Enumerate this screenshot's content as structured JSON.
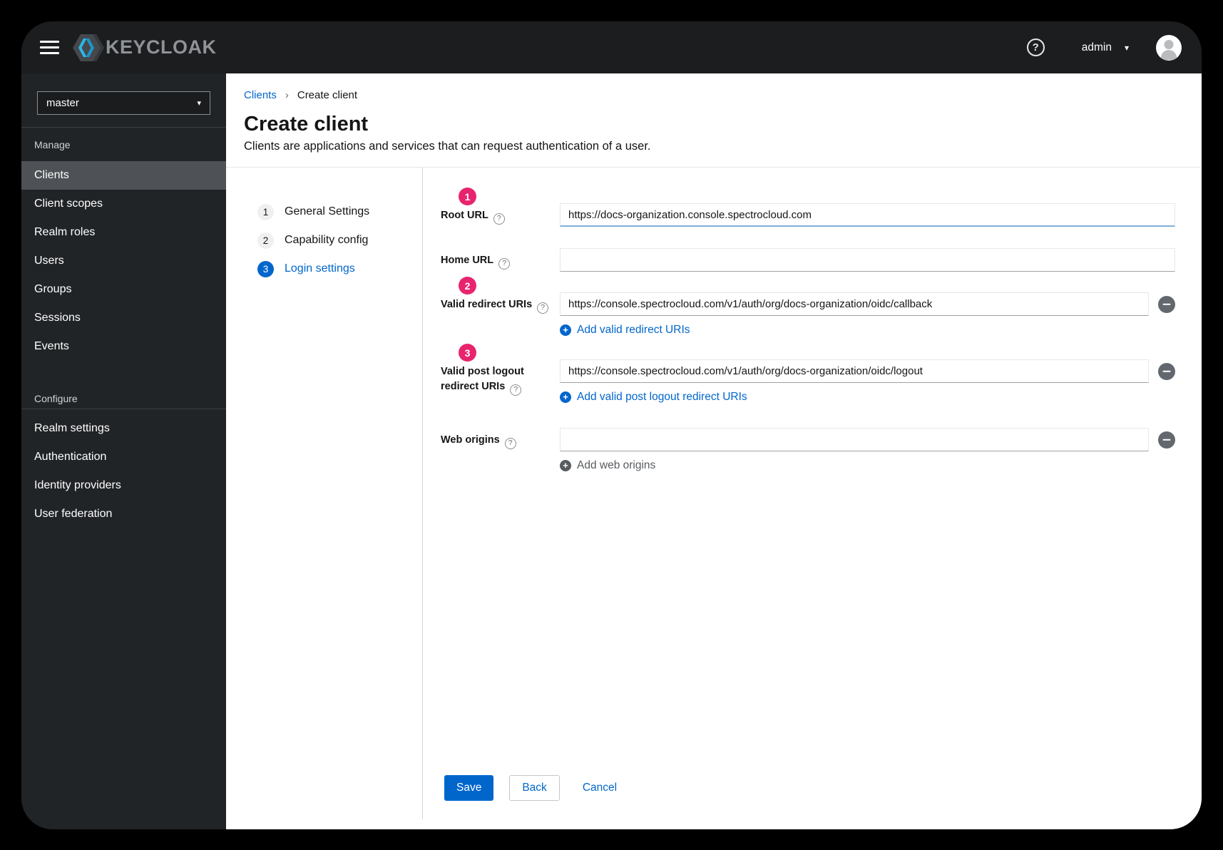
{
  "topbar": {
    "brand": "KEYCLOAK",
    "username": "admin"
  },
  "sidebar": {
    "realm": "master",
    "sections": [
      {
        "label": "Manage",
        "items": [
          {
            "label": "Clients",
            "active": true
          },
          {
            "label": "Client scopes",
            "active": false
          },
          {
            "label": "Realm roles",
            "active": false
          },
          {
            "label": "Users",
            "active": false
          },
          {
            "label": "Groups",
            "active": false
          },
          {
            "label": "Sessions",
            "active": false
          },
          {
            "label": "Events",
            "active": false
          }
        ]
      },
      {
        "label": "Configure",
        "items": [
          {
            "label": "Realm settings",
            "active": false
          },
          {
            "label": "Authentication",
            "active": false
          },
          {
            "label": "Identity providers",
            "active": false
          },
          {
            "label": "User federation",
            "active": false
          }
        ]
      }
    ]
  },
  "breadcrumb": {
    "link": "Clients",
    "separator": "›",
    "current": "Create client"
  },
  "page": {
    "title": "Create client",
    "subtitle": "Clients are applications and services that can request authentication of a user."
  },
  "wizard": {
    "steps": [
      {
        "number": "1",
        "label": "General Settings",
        "active": false
      },
      {
        "number": "2",
        "label": "Capability config",
        "active": false
      },
      {
        "number": "3",
        "label": "Login settings",
        "active": true
      }
    ]
  },
  "form": {
    "fields": [
      {
        "badge": "1",
        "label": "Root URL",
        "value": "https://docs-organization.console.spectrocloud.com",
        "focused": true
      },
      {
        "label": "Home URL",
        "value": ""
      },
      {
        "badge": "2",
        "label": "Valid redirect URIs",
        "value": "https://console.spectrocloud.com/v1/auth/org/docs-organization/oidc/callback",
        "add_label": "Add valid redirect URIs",
        "removable": true
      },
      {
        "badge": "3",
        "label": "Valid post logout redirect URIs",
        "value": "https://console.spectrocloud.com/v1/auth/org/docs-organization/oidc/logout",
        "add_label": "Add valid post logout redirect URIs",
        "removable": true
      },
      {
        "label": "Web origins",
        "value": "",
        "add_label": "Add web origins",
        "add_disabled": true,
        "removable": true
      }
    ]
  },
  "actions": {
    "save": "Save",
    "back": "Back",
    "cancel": "Cancel"
  },
  "glyphs": {
    "help": "?",
    "caret": "▾",
    "breadcrumb_separator": "›"
  },
  "colors": {
    "accent_blue": "#0066cc",
    "badge_pink": "#e7246d",
    "topbar_bg": "#1b1d1f",
    "sidebar_bg": "#212427",
    "active_item_bg": "#4e5256",
    "focus_underline": "#7fb0dc",
    "logo_cyan": "#2bb8e8"
  }
}
